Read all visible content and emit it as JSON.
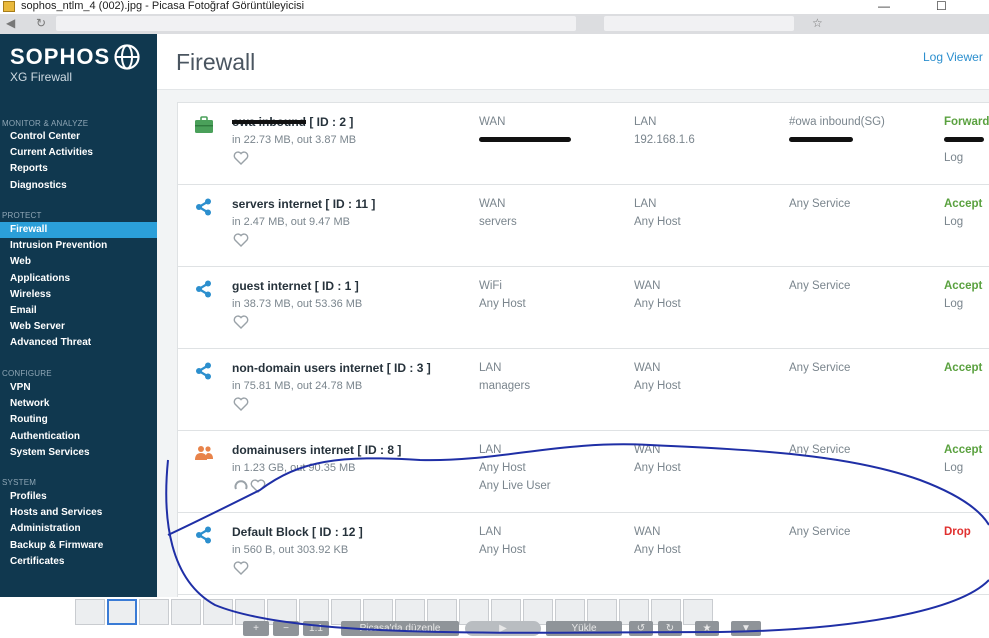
{
  "window": {
    "title": "sophos_ntlm_4 (002).jpg - Picasa Fotoğraf Görüntüleyicisi",
    "minimize": "—",
    "maximize": "☐",
    "close": "✕"
  },
  "sidebar": {
    "brand": "SOPHOS",
    "product": "XG Firewall",
    "sections": [
      {
        "label": "MONITOR & ANALYZE",
        "items": [
          "Control Center",
          "Current Activities",
          "Reports",
          "Diagnostics"
        ]
      },
      {
        "label": "PROTECT",
        "items": [
          "Firewall",
          "Intrusion Prevention",
          "Web",
          "Applications",
          "Wireless",
          "Email",
          "Web Server",
          "Advanced Threat"
        ]
      },
      {
        "label": "CONFIGURE",
        "items": [
          "VPN",
          "Network",
          "Routing",
          "Authentication",
          "System Services"
        ]
      },
      {
        "label": "SYSTEM",
        "items": [
          "Profiles",
          "Hosts and Services",
          "Administration",
          "Backup & Firmware",
          "Certificates"
        ]
      }
    ],
    "active_item": "Firewall"
  },
  "header": {
    "title": "Firewall",
    "log_viewer": "Log Viewer"
  },
  "rules": [
    {
      "name": "owa inbound",
      "id": "[ ID : 2 ]",
      "traffic": "in 22.73 MB, out 3.87 MB",
      "source": "WAN",
      "source2": "",
      "dest": "LAN",
      "dest2": "192.168.1.6",
      "dest3": "",
      "service": "#owa inbound(SG)",
      "action": "Forward",
      "action2": "",
      "log": "Log",
      "icon": "briefcase"
    },
    {
      "name": "servers internet",
      "id": "[ ID : 11 ]",
      "traffic": "in 2.47 MB, out 9.47 MB",
      "source": "WAN",
      "source2": "",
      "dest": "LAN",
      "dest2": "servers",
      "dest3": "",
      "service": "Any Service",
      "action": "Accept",
      "action2": "",
      "log": "Log",
      "icon": "share"
    },
    {
      "name": "guest internet",
      "id": "[ ID : 1 ]",
      "traffic": "in 38.73 MB, out 53.36 MB",
      "source": "WiFi",
      "source2": "Any Host",
      "dest": "WAN",
      "dest2": "Any Host",
      "dest3": "",
      "service": "Any Service",
      "action": "Accept",
      "action2": "",
      "log": "Log",
      "icon": "share"
    },
    {
      "name": "non-domain users internet",
      "id": "[ ID : 3 ]",
      "traffic": "in 75.81 MB, out 24.78 MB",
      "source": "LAN",
      "source2": "managers",
      "dest": "WAN",
      "dest2": "Any Host",
      "dest3": "",
      "service": "Any Service",
      "action": "Accept",
      "action2": "",
      "log": "",
      "icon": "share"
    },
    {
      "name": "domainusers internet",
      "id": "[ ID : 8 ]",
      "traffic": "in 1.23 GB, out 90.35 MB",
      "source": "LAN",
      "source2": "Any Host",
      "source3": "Any Live User",
      "dest": "WAN",
      "dest2": "Any Host",
      "dest3": "",
      "service": "Any Service",
      "action": "Accept",
      "action2": "",
      "log": "Log",
      "icon": "users"
    },
    {
      "name": "Default Block",
      "id": "[ ID : 12 ]",
      "traffic": "in 560 B, out 303.92 KB",
      "source": "LAN",
      "source2": "Any Host",
      "dest": "WAN",
      "dest2": "Any Host",
      "dest3": "",
      "service": "Any Service",
      "action": "Drop",
      "action2": "",
      "log": "",
      "icon": "share"
    }
  ],
  "picasa": {
    "edit_label": "Picasa'da düzenle",
    "upload_label": "Yükle",
    "zoom_label": "1:1"
  },
  "colors": {
    "sidebar_bg": "#10384f",
    "active_item": "#2b9fd9",
    "accept": "#5aa13f",
    "drop": "#e0302f",
    "link": "#2c8fce"
  }
}
